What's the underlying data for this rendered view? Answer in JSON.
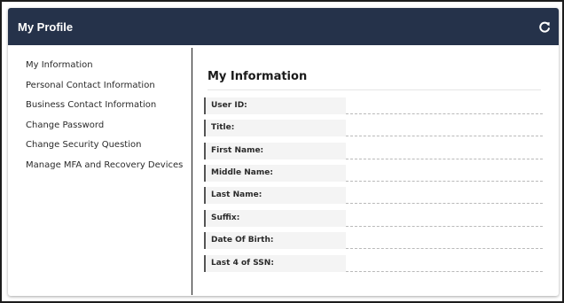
{
  "header": {
    "title": "My Profile",
    "refresh_icon": "refresh-icon"
  },
  "colors": {
    "header_bg": "#25324a",
    "header_text": "#ffffff"
  },
  "sidebar": {
    "items": [
      {
        "label": "My Information"
      },
      {
        "label": "Personal Contact Information"
      },
      {
        "label": "Business Contact Information"
      },
      {
        "label": "Change Password"
      },
      {
        "label": "Change Security Question"
      },
      {
        "label": "Manage MFA and Recovery Devices"
      }
    ]
  },
  "main": {
    "title": "My Information",
    "fields": [
      {
        "label": "User ID:",
        "value": ""
      },
      {
        "label": "Title:",
        "value": ""
      },
      {
        "label": "First Name:",
        "value": ""
      },
      {
        "label": "Middle Name:",
        "value": ""
      },
      {
        "label": "Last Name:",
        "value": ""
      },
      {
        "label": "Suffix:",
        "value": ""
      },
      {
        "label": "Date Of Birth:",
        "value": ""
      },
      {
        "label": "Last 4 of SSN:",
        "value": ""
      }
    ]
  }
}
